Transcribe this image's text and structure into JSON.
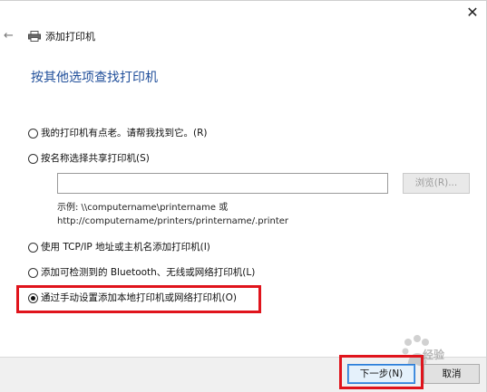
{
  "window": {
    "title": "添加打印机",
    "close_glyph": "✕",
    "back_glyph": "←"
  },
  "page": {
    "title": "按其他选项查找打印机"
  },
  "options": [
    {
      "label": "我的打印机有点老。请帮我找到它。(R)",
      "selected": false
    },
    {
      "label": "按名称选择共享打印机(S)",
      "selected": false
    },
    {
      "label": "使用 TCP/IP 地址或主机名添加打印机(I)",
      "selected": false
    },
    {
      "label": "添加可检测到的 Bluetooth、无线或网络打印机(L)",
      "selected": false
    },
    {
      "label": "通过手动设置添加本地打印机或网络打印机(O)",
      "selected": true
    }
  ],
  "shared_printer": {
    "input_value": "",
    "browse_label": "浏览(R)...",
    "example_line1": "示例: \\\\computername\\printername 或",
    "example_line2": "http://computername/printers/printername/.printer"
  },
  "footer": {
    "next_label": "下一步(N)",
    "cancel_label": "取消"
  },
  "watermark": {
    "text": "经验"
  },
  "colors": {
    "title_blue": "#1f4e9a",
    "highlight_red": "#e0141c",
    "default_button_border": "#2b7bd6"
  }
}
